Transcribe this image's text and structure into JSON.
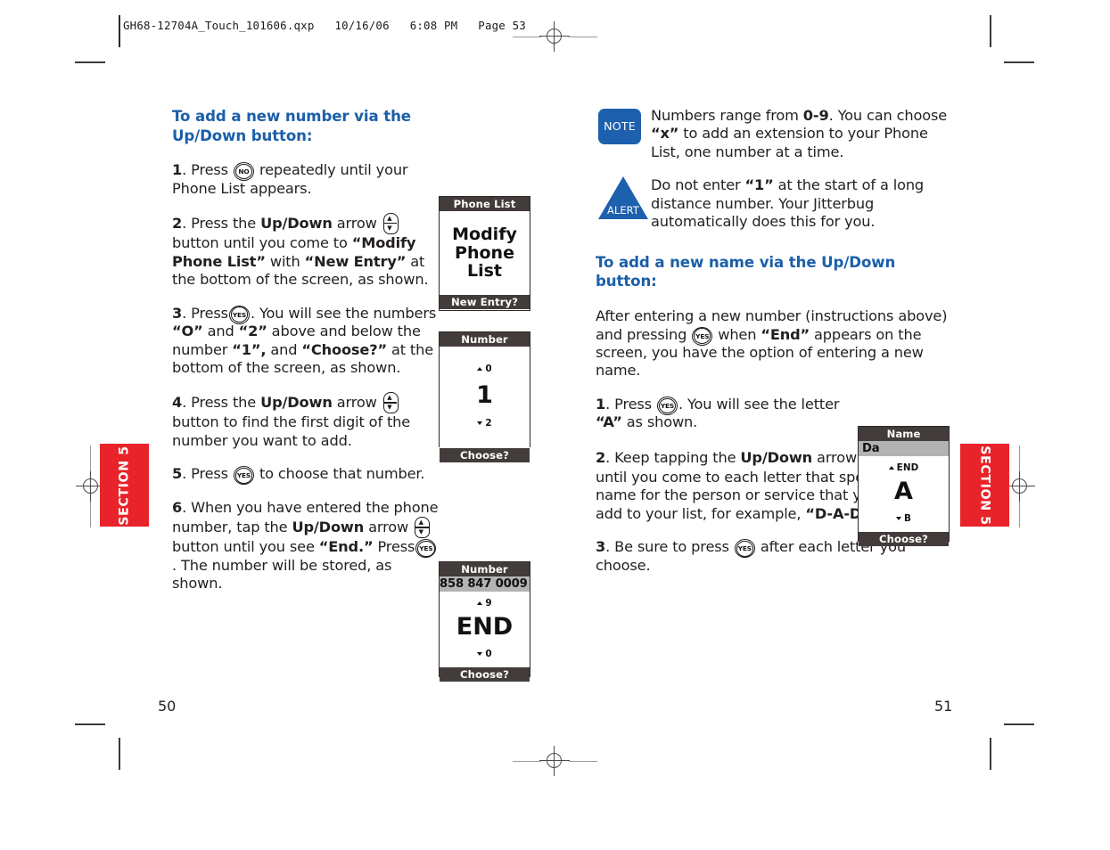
{
  "document": {
    "file_header": "GH68-12704A_Touch_101606.qxp   10/16/06   6:08 PM   Page 53",
    "section_tab_left": "SECTION 5",
    "section_tab_right": "SECTION 5",
    "folio_left": "50",
    "folio_right": "51",
    "brand_colors": {
      "heading_blue": "#1b5faa",
      "badge_blue": "#1d60ad",
      "tab_red": "#e8232a",
      "lcd_bar": "#423c3a",
      "lcd_highlight": "#b3b3b3"
    }
  },
  "left_column": {
    "heading": "To add a new number via the Up/Down button:",
    "steps": {
      "s1_num": "1",
      "s1_a": ". Press ",
      "s1_key": "NO",
      "s1_b": " repeatedly until your Phone List appears.",
      "s2_num": "2",
      "s2_a": ". Press the ",
      "s2_bold1": "Up/Down",
      "s2_b": " arrow ",
      "s2_c": " button until you come to ",
      "s2_bold2": "“Modify Phone List”",
      "s2_d": " with ",
      "s2_bold3": "“New Entry”",
      "s2_e": " at the bottom of the screen, as shown.",
      "s3_num": "3",
      "s3_a": ". Press",
      "s3_key": "YES",
      "s3_b": ". You will see the numbers ",
      "s3_bold1": "“O”",
      "s3_c": " and ",
      "s3_bold2": "“2”",
      "s3_d": " above and below the number ",
      "s3_bold3": "“1”,",
      "s3_e": " and ",
      "s3_bold4": "“Choose?”",
      "s3_f": " at the bottom of the screen, as shown.",
      "s4_num": "4",
      "s4_a": ". Press the ",
      "s4_bold1": "Up/Down",
      "s4_b": " arrow ",
      "s4_c": " button to find the first digit of the number you want to add.",
      "s5_num": "5",
      "s5_a": ". Press ",
      "s5_key": "YES",
      "s5_b": " to choose that number.",
      "s6_num": "6",
      "s6_a": ". When you have entered the phone number, tap the ",
      "s6_bold1": "Up/Down",
      "s6_b": " arrow ",
      "s6_c": " button until you see ",
      "s6_bold2": "“End.”",
      "s6_d": " Press",
      "s6_key": "YES",
      "s6_e": ". The number will be stored, as shown."
    }
  },
  "right_column": {
    "note": {
      "badge": "NOTE",
      "a": "Numbers range from ",
      "bold1": "0-9",
      "b": ". You can choose ",
      "bold2": "“x”",
      "c": " to add an extension to your Phone List, one number at a time."
    },
    "alert": {
      "badge": "ALERT",
      "a": "Do not enter ",
      "bold1": "“1”",
      "b": " at the start of a long distance number. Your Jitterbug automatically does this for you."
    },
    "heading": "To add a new name via the Up/Down button:",
    "intro": {
      "a": "After entering a new number (instructions above) and pressing ",
      "key": "YES",
      "b": " when ",
      "bold1": "“End”",
      "c": " appears on the screen, you have the option of entering a new name."
    },
    "steps": {
      "s1_num": "1",
      "s1_a": ". Press ",
      "s1_key": "YES",
      "s1_b": ". You will see the letter ",
      "s1_bold1": "“A”",
      "s1_c": " as shown.",
      "s2_num": "2",
      "s2_a": ". Keep tapping the ",
      "s2_bold1": "Up/Down",
      "s2_b": " arrow ",
      "s2_c": " button until you come to each letter that spells a short name for the person or service that you want to add to your list, for example, ",
      "s2_bold2": "“D-A-D.”",
      "s3_num": "3",
      "s3_a": ". Be sure to press ",
      "s3_key": "YES",
      "s3_b": " after each letter you choose."
    }
  },
  "lcd_screens": {
    "phone_list": {
      "title": "Phone List",
      "main_line1": "Modify",
      "main_line2": "Phone",
      "main_line3": "List",
      "footer": "New Entry?"
    },
    "number_one": {
      "title": "Number",
      "option_up": "0",
      "main": "1",
      "option_down": "2",
      "footer": "Choose?"
    },
    "number_end": {
      "title": "Number",
      "entry": "858 847 0009",
      "option_up": "9",
      "main": "END",
      "option_down": "0",
      "footer": "Choose?"
    },
    "name_a": {
      "title": "Name",
      "entry": "Da",
      "option_up": "END",
      "main": "A",
      "option_down": "B",
      "footer": "Choose?"
    }
  }
}
